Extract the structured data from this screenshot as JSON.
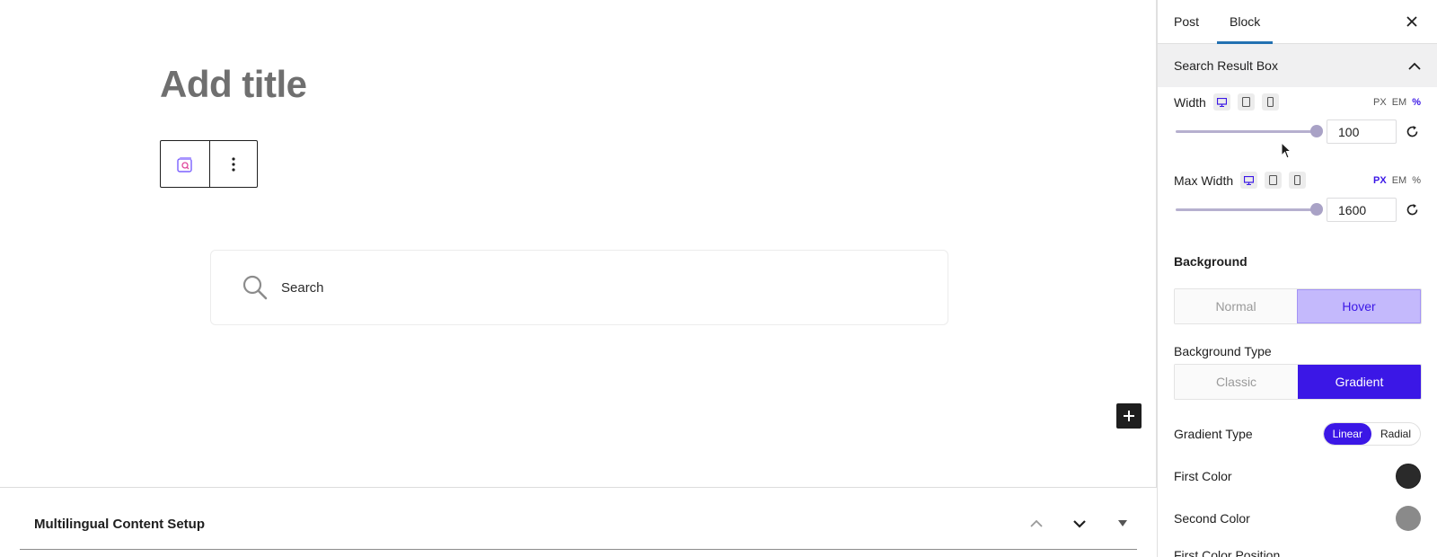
{
  "editor": {
    "title_placeholder": "Add title",
    "search": {
      "placeholder": "Search"
    },
    "metabox": {
      "title": "Multilingual Content Setup"
    }
  },
  "sidebar": {
    "tabs": [
      {
        "label": "Post"
      },
      {
        "label": "Block"
      }
    ],
    "active_tab": "Block",
    "panel": {
      "title": "Search Result Box",
      "expanded": true
    },
    "width": {
      "label": "Width",
      "units": [
        "PX",
        "EM",
        "%"
      ],
      "active_unit": "%",
      "value": "100",
      "slider_fraction": 1.0
    },
    "max_width": {
      "label": "Max Width",
      "units": [
        "PX",
        "EM",
        "%"
      ],
      "active_unit": "PX",
      "value": "1600",
      "slider_fraction": 1.0
    },
    "background": {
      "title": "Background",
      "state_options": [
        "Normal",
        "Hover"
      ],
      "active_state": "Hover",
      "type_label": "Background Type",
      "type_options": [
        "Classic",
        "Gradient"
      ],
      "active_type": "Gradient",
      "gradient_type_label": "Gradient Type",
      "gradient_type_options": [
        "Linear",
        "Radial"
      ],
      "active_gradient_type": "Linear",
      "first_color_label": "First Color",
      "first_color": "#2a2a2a",
      "second_color_label": "Second Color",
      "second_color": "#8a8a8a",
      "first_color_position_label": "First Color Position"
    }
  },
  "colors": {
    "accent": "#3b17e6",
    "tab_underline": "#2271b1",
    "hover_fill": "#c4b9fc"
  }
}
